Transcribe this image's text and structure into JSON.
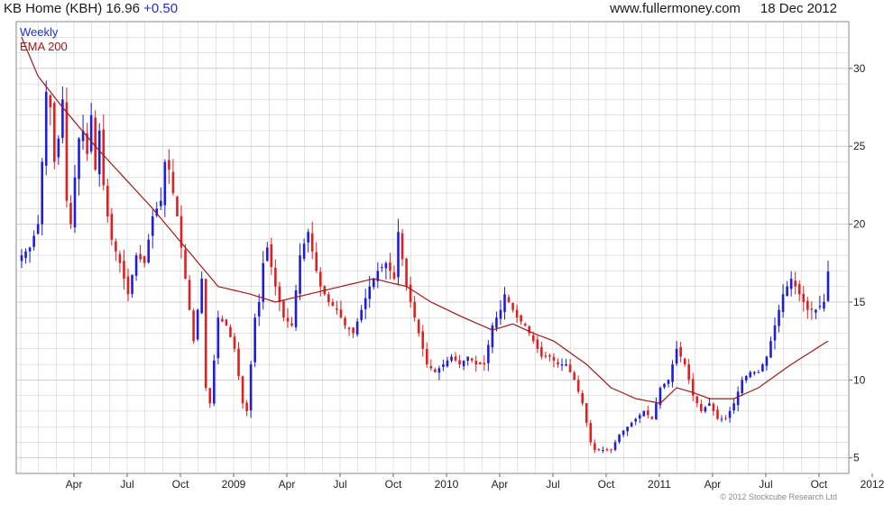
{
  "header": {
    "ticker": "KB Home (KBH)",
    "price": "16.96",
    "change": "+0.50",
    "website": "www.fullermoney.com",
    "date": "18 Dec 2012"
  },
  "legend": {
    "period": "Weekly",
    "indicator": "EMA 200"
  },
  "copyright": "© 2012 Stockcube Research Ltd",
  "colors": {
    "up": "#1e1ed8",
    "down": "#e02020",
    "ema": "#a01818",
    "grid": "#c8c8c8"
  },
  "chart_data": {
    "type": "candlestick",
    "interval": "weekly",
    "date_range": [
      "2008-01",
      "2012-12"
    ],
    "ylim": [
      4,
      33
    ],
    "y_ticks": [
      5,
      10,
      15,
      20,
      25,
      30
    ],
    "x_labels": [
      "Apr",
      "Jul",
      "Oct",
      "2009",
      "Apr",
      "Jul",
      "Oct",
      "2010",
      "Apr",
      "Jul",
      "Oct",
      "2011",
      "Apr",
      "Jul",
      "Oct",
      "2012",
      "Apr",
      "Jul",
      "Oct"
    ],
    "grid": true,
    "close_anchors": [
      [
        0,
        18.0
      ],
      [
        2,
        18.5
      ],
      [
        4,
        20.0
      ],
      [
        5,
        24.0
      ],
      [
        6,
        28.5
      ],
      [
        7,
        27.5
      ],
      [
        8,
        24.0
      ],
      [
        9,
        25.5
      ],
      [
        10,
        28.0
      ],
      [
        11,
        21.5
      ],
      [
        12,
        20.0
      ],
      [
        13,
        23.0
      ],
      [
        14,
        25.5
      ],
      [
        15,
        26.0
      ],
      [
        16,
        24.5
      ],
      [
        17,
        27.0
      ],
      [
        18,
        23.5
      ],
      [
        19,
        26.0
      ],
      [
        20,
        22.5
      ],
      [
        21,
        20.5
      ],
      [
        22,
        19.0
      ],
      [
        24,
        17.5
      ],
      [
        26,
        15.5
      ],
      [
        28,
        18.0
      ],
      [
        30,
        17.5
      ],
      [
        32,
        20.5
      ],
      [
        34,
        21.5
      ],
      [
        35,
        24.0
      ],
      [
        36,
        23.5
      ],
      [
        38,
        20.5
      ],
      [
        40,
        16.5
      ],
      [
        42,
        12.5
      ],
      [
        44,
        16.5
      ],
      [
        45,
        9.5
      ],
      [
        46,
        8.5
      ],
      [
        48,
        14.0
      ],
      [
        50,
        13.5
      ],
      [
        52,
        12.0
      ],
      [
        54,
        8.5
      ],
      [
        55,
        8.0
      ],
      [
        57,
        14.0
      ],
      [
        58,
        15.0
      ],
      [
        59,
        17.5
      ],
      [
        60,
        18.5
      ],
      [
        62,
        16.0
      ],
      [
        64,
        14.0
      ],
      [
        66,
        13.5
      ],
      [
        68,
        18.0
      ],
      [
        70,
        19.5
      ],
      [
        72,
        17.0
      ],
      [
        73,
        16.0
      ],
      [
        75,
        15.0
      ],
      [
        77,
        14.5
      ],
      [
        79,
        13.5
      ],
      [
        81,
        13.0
      ],
      [
        83,
        14.5
      ],
      [
        85,
        16.0
      ],
      [
        87,
        17.0
      ],
      [
        89,
        17.5
      ],
      [
        91,
        16.5
      ],
      [
        92,
        19.5
      ],
      [
        94,
        16.0
      ],
      [
        96,
        14.0
      ],
      [
        97,
        13.0
      ],
      [
        99,
        11.0
      ],
      [
        101,
        10.5
      ],
      [
        103,
        11.0
      ],
      [
        105,
        11.5
      ],
      [
        107,
        11.0
      ],
      [
        109,
        11.5
      ],
      [
        111,
        11.0
      ],
      [
        113,
        11.0
      ],
      [
        115,
        13.5
      ],
      [
        117,
        14.5
      ],
      [
        118,
        15.5
      ],
      [
        119,
        15.0
      ],
      [
        121,
        14.0
      ],
      [
        123,
        13.5
      ],
      [
        125,
        12.5
      ],
      [
        127,
        11.5
      ],
      [
        129,
        11.5
      ],
      [
        131,
        11.0
      ],
      [
        133,
        11.0
      ],
      [
        135,
        10.0
      ],
      [
        137,
        8.5
      ],
      [
        139,
        6.0
      ],
      [
        140,
        5.5
      ],
      [
        142,
        5.5
      ],
      [
        144,
        5.5
      ],
      [
        146,
        6.5
      ],
      [
        148,
        7.0
      ],
      [
        150,
        7.5
      ],
      [
        152,
        8.0
      ],
      [
        154,
        7.5
      ],
      [
        156,
        9.5
      ],
      [
        158,
        10.0
      ],
      [
        160,
        12.0
      ],
      [
        162,
        11.0
      ],
      [
        164,
        9.0
      ],
      [
        166,
        8.0
      ],
      [
        168,
        8.5
      ],
      [
        170,
        7.5
      ],
      [
        172,
        7.5
      ],
      [
        174,
        8.5
      ],
      [
        176,
        10.0
      ],
      [
        178,
        10.5
      ],
      [
        180,
        10.5
      ],
      [
        182,
        11.5
      ],
      [
        184,
        13.5
      ],
      [
        186,
        15.5
      ],
      [
        188,
        16.5
      ],
      [
        190,
        15.5
      ],
      [
        192,
        14.5
      ],
      [
        194,
        14.5
      ],
      [
        196,
        15.0
      ],
      [
        197,
        16.96
      ]
    ],
    "ema200": [
      [
        0,
        32.0
      ],
      [
        4,
        29.5
      ],
      [
        10,
        27.5
      ],
      [
        18,
        25.0
      ],
      [
        25,
        23.0
      ],
      [
        32,
        21.0
      ],
      [
        40,
        18.5
      ],
      [
        48,
        16.0
      ],
      [
        56,
        15.5
      ],
      [
        62,
        15.0
      ],
      [
        70,
        15.5
      ],
      [
        78,
        16.0
      ],
      [
        86,
        16.5
      ],
      [
        94,
        16.0
      ],
      [
        100,
        15.0
      ],
      [
        108,
        14.0
      ],
      [
        115,
        13.2
      ],
      [
        120,
        13.6
      ],
      [
        125,
        13.0
      ],
      [
        130,
        12.5
      ],
      [
        138,
        11.0
      ],
      [
        144,
        9.5
      ],
      [
        150,
        8.8
      ],
      [
        156,
        8.5
      ],
      [
        160,
        9.5
      ],
      [
        164,
        9.2
      ],
      [
        168,
        8.8
      ],
      [
        174,
        8.8
      ],
      [
        180,
        9.5
      ],
      [
        188,
        11.0
      ],
      [
        194,
        12.0
      ],
      [
        197,
        12.5
      ]
    ]
  }
}
